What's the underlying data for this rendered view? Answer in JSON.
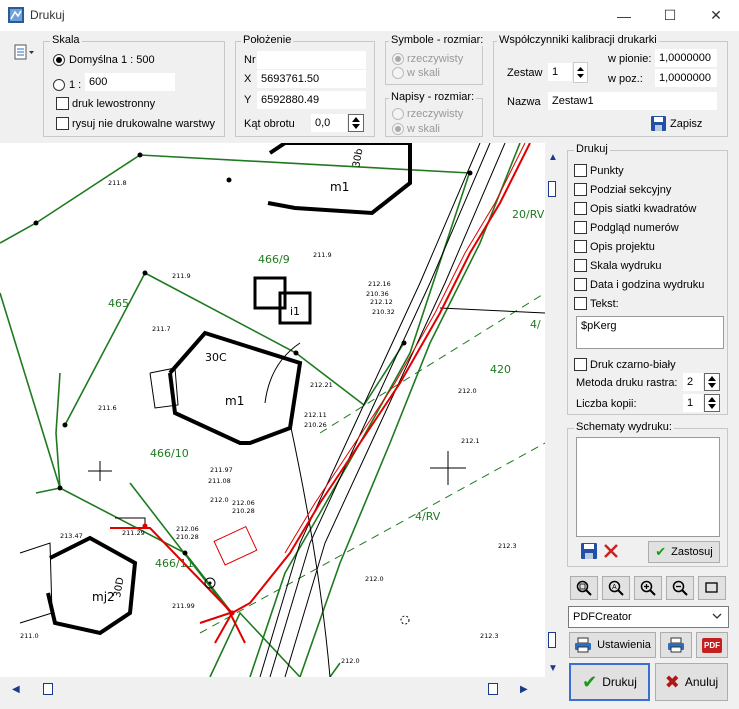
{
  "window": {
    "title": "Drukuj",
    "minimize": "—",
    "maximize": "☐",
    "close": "✕"
  },
  "skala": {
    "legend": "Skala",
    "default_option": "Domyślna 1 : 500",
    "custom_prefix": "1 :",
    "custom_value": "600",
    "option_lewostronny": "druk lewostronny",
    "option_niedrukowalne": "rysuj nie drukowalne warstwy"
  },
  "polozenie": {
    "legend": "Położenie",
    "nr_label": "Nr",
    "nr_value": "",
    "x_label": "X",
    "x_value": "5693761.50",
    "y_label": "Y",
    "y_value": "6592880.49",
    "kat_label": "Kąt obrotu",
    "kat_value": "0,0"
  },
  "symbole": {
    "legend": "Symbole - rozmiar:",
    "opt1": "rzeczywisty",
    "opt2": "w skali"
  },
  "napisy": {
    "legend": "Napisy - rozmiar:",
    "opt1": "rzeczywisty",
    "opt2": "w skali"
  },
  "kalibracja": {
    "legend": "Współczynniki kalibracji drukarki",
    "zestaw_label": "Zestaw",
    "zestaw_value": "1",
    "pion_label": "w pionie:",
    "pion_value": "1,0000000",
    "poz_label": "w poz.:",
    "poz_value": "1,0000000",
    "nazwa_label": "Nazwa",
    "nazwa_value": "Zestaw1",
    "zapisz": "Zapisz"
  },
  "drukuj_panel": {
    "legend": "Drukuj",
    "options": [
      "Punkty",
      "Podział sekcyjny",
      "Opis siatki kwadratów",
      "Podgląd numerów",
      "Opis projektu",
      "Skala wydruku",
      "Data i godzina wydruku",
      "Tekst:"
    ],
    "text_value": "$pKerg",
    "czarno_bialy": "Druk czarno-biały",
    "metoda_label": "Metoda druku rastra:",
    "metoda_value": "2",
    "kopie_label": "Liczba kopii:",
    "kopie_value": "1"
  },
  "schematy": {
    "legend": "Schematy wydruku:",
    "zastosuj": "Zastosuj"
  },
  "printer": {
    "name": "PDFCreator",
    "ustawienia": "Ustawienia",
    "pdf_label": "PDF"
  },
  "actions": {
    "drukuj": "Drukuj",
    "anuluj": "Anuluj"
  },
  "map": {
    "parcel_labels": [
      "465",
      "466/9",
      "466/10",
      "466/11",
      "420",
      "4/RV",
      "20/RV",
      "4/"
    ],
    "building_labels": [
      "m1",
      "30b",
      "i1",
      "30C",
      "m1",
      "mj2",
      "30D"
    ],
    "heights": [
      "211.8",
      "211.9",
      "211.9",
      "211.7",
      "211.6",
      "212.16",
      "210.36",
      "212.12",
      "210.32",
      "212.11",
      "210.26",
      "212.21",
      "211.97",
      "211.08",
      "212.0",
      "212.06",
      "210.28",
      "212.06",
      "210.28",
      "211.29",
      "213.47",
      "212.0",
      "212.1",
      "212.3",
      "212.0",
      "212.3",
      "212.1",
      "211.99",
      "211.0"
    ],
    "colors": {
      "parcel": "#1f7a1f",
      "building": "#000000",
      "utility": "#e00000"
    }
  }
}
